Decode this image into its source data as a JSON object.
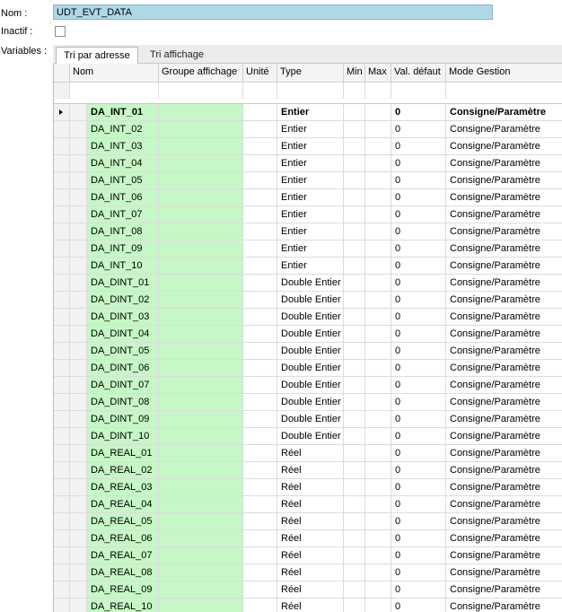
{
  "labels": {
    "nom": "Nom :",
    "inactif": "Inactif :",
    "variables": "Variables :"
  },
  "nom_value": "UDT_EVT_DATA",
  "inactif_checked": false,
  "tabs": [
    "Tri par adresse",
    "Tri affichage"
  ],
  "active_tab": 0,
  "columns": [
    "Nom",
    "Groupe affichage",
    "Unité",
    "Type",
    "Min",
    "Max",
    "Val. défaut",
    "Mode Gestion"
  ],
  "rows": [
    {
      "name": "DA_INT_01",
      "type": "Entier",
      "default": "0",
      "mode": "Consigne/Paramètre"
    },
    {
      "name": "DA_INT_02",
      "type": "Entier",
      "default": "0",
      "mode": "Consigne/Paramètre"
    },
    {
      "name": "DA_INT_03",
      "type": "Entier",
      "default": "0",
      "mode": "Consigne/Paramètre"
    },
    {
      "name": "DA_INT_04",
      "type": "Entier",
      "default": "0",
      "mode": "Consigne/Paramètre"
    },
    {
      "name": "DA_INT_05",
      "type": "Entier",
      "default": "0",
      "mode": "Consigne/Paramètre"
    },
    {
      "name": "DA_INT_06",
      "type": "Entier",
      "default": "0",
      "mode": "Consigne/Paramètre"
    },
    {
      "name": "DA_INT_07",
      "type": "Entier",
      "default": "0",
      "mode": "Consigne/Paramètre"
    },
    {
      "name": "DA_INT_08",
      "type": "Entier",
      "default": "0",
      "mode": "Consigne/Paramètre"
    },
    {
      "name": "DA_INT_09",
      "type": "Entier",
      "default": "0",
      "mode": "Consigne/Paramètre"
    },
    {
      "name": "DA_INT_10",
      "type": "Entier",
      "default": "0",
      "mode": "Consigne/Paramètre"
    },
    {
      "name": "DA_DINT_01",
      "type": "Double Entier",
      "default": "0",
      "mode": "Consigne/Paramètre"
    },
    {
      "name": "DA_DINT_02",
      "type": "Double Entier",
      "default": "0",
      "mode": "Consigne/Paramètre"
    },
    {
      "name": "DA_DINT_03",
      "type": "Double Entier",
      "default": "0",
      "mode": "Consigne/Paramètre"
    },
    {
      "name": "DA_DINT_04",
      "type": "Double Entier",
      "default": "0",
      "mode": "Consigne/Paramètre"
    },
    {
      "name": "DA_DINT_05",
      "type": "Double Entier",
      "default": "0",
      "mode": "Consigne/Paramètre"
    },
    {
      "name": "DA_DINT_06",
      "type": "Double Entier",
      "default": "0",
      "mode": "Consigne/Paramètre"
    },
    {
      "name": "DA_DINT_07",
      "type": "Double Entier",
      "default": "0",
      "mode": "Consigne/Paramètre"
    },
    {
      "name": "DA_DINT_08",
      "type": "Double Entier",
      "default": "0",
      "mode": "Consigne/Paramètre"
    },
    {
      "name": "DA_DINT_09",
      "type": "Double Entier",
      "default": "0",
      "mode": "Consigne/Paramètre"
    },
    {
      "name": "DA_DINT_10",
      "type": "Double Entier",
      "default": "0",
      "mode": "Consigne/Paramètre"
    },
    {
      "name": "DA_REAL_01",
      "type": "Réel",
      "default": "0",
      "mode": "Consigne/Paramètre"
    },
    {
      "name": "DA_REAL_02",
      "type": "Réel",
      "default": "0",
      "mode": "Consigne/Paramètre"
    },
    {
      "name": "DA_REAL_03",
      "type": "Réel",
      "default": "0",
      "mode": "Consigne/Paramètre"
    },
    {
      "name": "DA_REAL_04",
      "type": "Réel",
      "default": "0",
      "mode": "Consigne/Paramètre"
    },
    {
      "name": "DA_REAL_05",
      "type": "Réel",
      "default": "0",
      "mode": "Consigne/Paramètre"
    },
    {
      "name": "DA_REAL_06",
      "type": "Réel",
      "default": "0",
      "mode": "Consigne/Paramètre"
    },
    {
      "name": "DA_REAL_07",
      "type": "Réel",
      "default": "0",
      "mode": "Consigne/Paramètre"
    },
    {
      "name": "DA_REAL_08",
      "type": "Réel",
      "default": "0",
      "mode": "Consigne/Paramètre"
    },
    {
      "name": "DA_REAL_09",
      "type": "Réel",
      "default": "0",
      "mode": "Consigne/Paramètre"
    },
    {
      "name": "DA_REAL_10",
      "type": "Réel",
      "default": "0",
      "mode": "Consigne/Paramètre"
    }
  ],
  "selected_row": 0,
  "colors": {
    "nom_field_bg": "#add8e6",
    "name_cell_bg": "#c6f7c6"
  }
}
